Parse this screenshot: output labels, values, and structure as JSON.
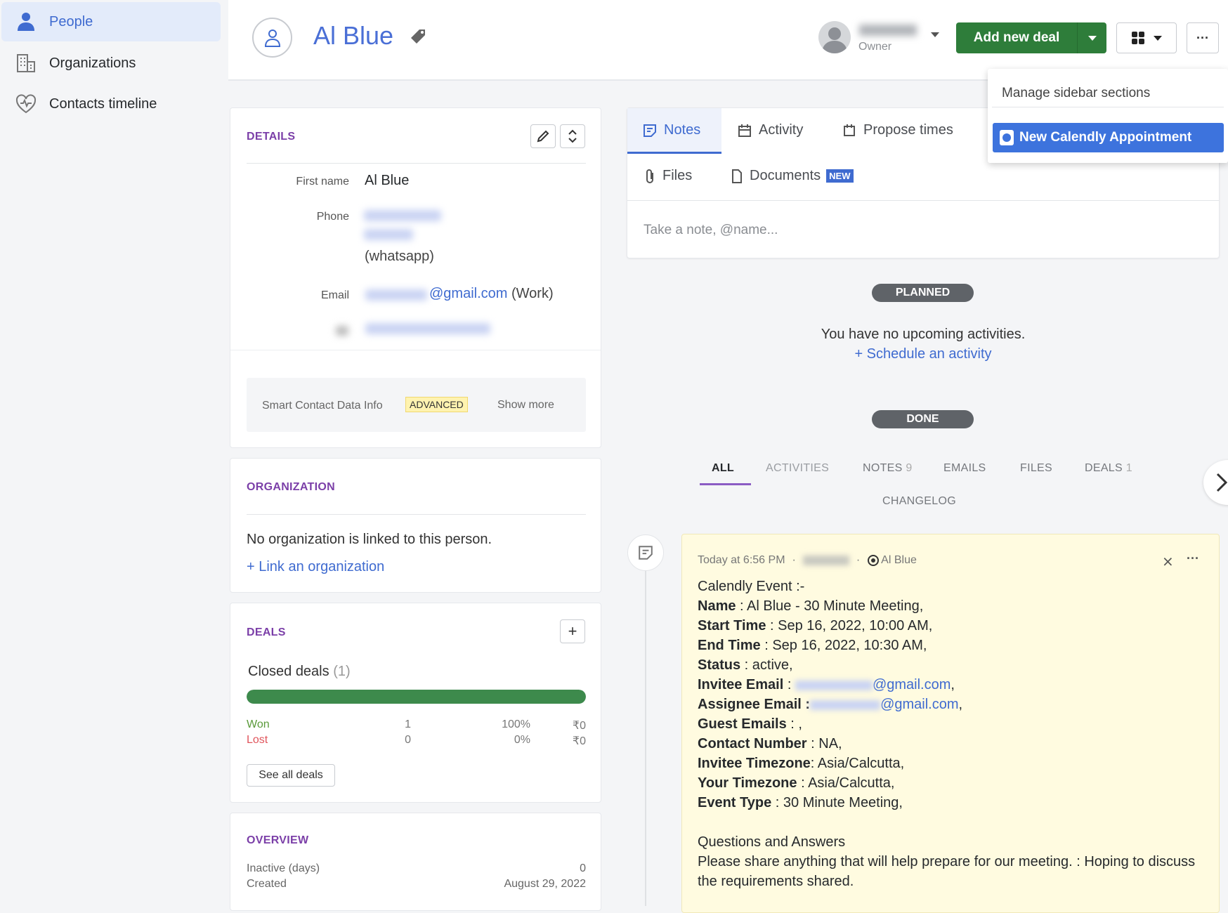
{
  "sidebar": {
    "items": [
      {
        "label": "People",
        "icon": "person-icon",
        "active": true
      },
      {
        "label": "Organizations",
        "icon": "building-icon"
      },
      {
        "label": "Contacts timeline",
        "icon": "heart-pulse-icon"
      }
    ]
  },
  "header": {
    "title": "Al Blue",
    "owner_label": "Owner",
    "add_deal_label": "Add new deal"
  },
  "dropdown": {
    "items": [
      "Manage sidebar sections",
      "New Calendly Appointment"
    ]
  },
  "details": {
    "title": "DETAILS",
    "first_name_label": "First name",
    "first_name": "Al Blue",
    "phone_label": "Phone",
    "phone_type": "(whatsapp)",
    "email_label": "Email",
    "email_domain": "@gmail.com",
    "email_type": "(Work)",
    "smart_label": "Smart Contact Data Info",
    "smart_badge": "ADVANCED",
    "show_more": "Show more"
  },
  "organization": {
    "title": "ORGANIZATION",
    "empty_text": "No organization is linked to this person.",
    "link_label": "+ Link an organization"
  },
  "deals": {
    "title": "DEALS",
    "closed_label": "Closed deals",
    "closed_count": "(1)",
    "won_fraction": 1.0,
    "rows": [
      {
        "label": "Won",
        "count": "1",
        "percent": "100%",
        "amount": "₹0",
        "color": "#5a9a3a"
      },
      {
        "label": "Lost",
        "count": "0",
        "percent": "0%",
        "amount": "₹0",
        "color": "#e0555c"
      }
    ],
    "see_all": "See all deals"
  },
  "overview": {
    "title": "OVERVIEW",
    "rows": [
      {
        "label": "Inactive (days)",
        "value": "0"
      },
      {
        "label": "Created",
        "value": "August 29, 2022"
      }
    ]
  },
  "composer": {
    "tabs": [
      "Notes",
      "Activity",
      "Propose times",
      "Files",
      "Documents"
    ],
    "new_badge": "NEW",
    "placeholder": "Take a note, @name..."
  },
  "planned": {
    "pill": "PLANNED",
    "empty_text": "You have no upcoming activities.",
    "schedule_link": "+ Schedule an activity"
  },
  "done": {
    "pill": "DONE"
  },
  "filters": [
    "ALL",
    "ACTIVITIES",
    "NOTES",
    "EMAILS",
    "FILES",
    "DEALS",
    "CHANGELOG"
  ],
  "filter_counts": {
    "notes": "9",
    "deals": "1"
  },
  "note": {
    "timestamp": "Today at 6:56 PM",
    "person": "Al Blue",
    "heading": "Calendly Event :-",
    "fields": [
      {
        "k": "Name",
        "v": " : Al Blue - 30 Minute Meeting,"
      },
      {
        "k": "Start Time",
        "v": " : Sep 16, 2022, 10:00 AM,"
      },
      {
        "k": "End Time",
        "v": " : Sep 16, 2022, 10:30 AM,"
      },
      {
        "k": "Status",
        "v": " : active,"
      },
      {
        "k": "Invitee Email",
        "v": " : ",
        "link": "@gmail.com",
        "tail": ","
      },
      {
        "k": "Assignee Email :",
        "v": "",
        "link": "@gmail.com",
        "tail": ","
      },
      {
        "k": "Guest Emails",
        "v": " : ,"
      },
      {
        "k": "Contact Number",
        "v": " : NA,"
      },
      {
        "k": "Invitee Timezone",
        "v": ": Asia/Calcutta,"
      },
      {
        "k": "Your Timezone",
        "v": " : Asia/Calcutta,"
      },
      {
        "k": "Event Type",
        "v": " : 30 Minute Meeting,"
      }
    ],
    "qa_heading": "Questions and Answers",
    "qa_text": "Please share anything that will help prepare for our meeting. : Hoping to discuss the requirements shared."
  }
}
